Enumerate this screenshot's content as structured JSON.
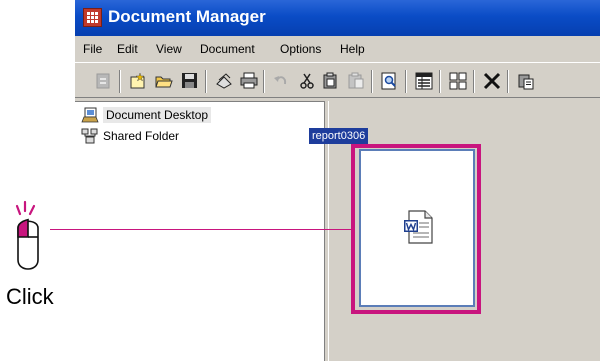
{
  "window": {
    "title": "Document Manager",
    "app_icon": "grid-app-icon"
  },
  "menubar": {
    "items": [
      "File",
      "Edit",
      "View",
      "Document",
      "Options",
      "Help"
    ]
  },
  "toolbar": {
    "buttons": [
      {
        "icon": "properties-icon",
        "enabled": false
      },
      {
        "icon": "new-icon",
        "enabled": true
      },
      {
        "icon": "open-folder-icon",
        "enabled": true
      },
      {
        "icon": "save-icon",
        "enabled": true
      },
      {
        "icon": "scan-icon",
        "enabled": true
      },
      {
        "icon": "print-icon",
        "enabled": true
      },
      {
        "icon": "undo-icon",
        "enabled": false
      },
      {
        "icon": "cut-icon",
        "enabled": true
      },
      {
        "icon": "copy-icon",
        "enabled": true
      },
      {
        "icon": "paste-icon",
        "enabled": false
      },
      {
        "icon": "preview-icon",
        "enabled": true
      },
      {
        "icon": "list-view-icon",
        "enabled": true
      },
      {
        "icon": "thumbnail-view-icon",
        "enabled": true
      },
      {
        "icon": "delete-icon",
        "enabled": true
      },
      {
        "icon": "clipboard-icon",
        "enabled": true
      }
    ]
  },
  "tree": {
    "items": [
      {
        "label": "Document Desktop",
        "icon": "desktop-icon",
        "selected": true
      },
      {
        "label": "Shared Folder",
        "icon": "network-folder-icon",
        "selected": false
      }
    ]
  },
  "document_pane": {
    "file": {
      "name": "report0306",
      "icon": "word-document-icon",
      "highlight_color": "#c8157e"
    }
  },
  "annotation": {
    "action": "Click",
    "icon": "mouse-left-click-icon",
    "color": "#c8157e"
  }
}
